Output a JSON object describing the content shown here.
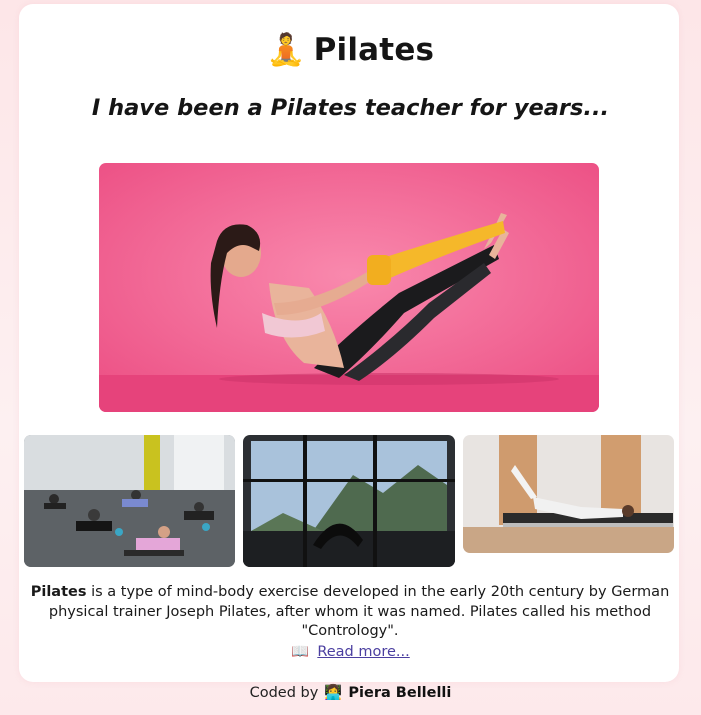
{
  "header": {
    "title_emoji": "🧘",
    "title": "Pilates",
    "subtitle": "I have been a Pilates teacher for years..."
  },
  "description": {
    "keyword": "Pilates",
    "text": " is a type of mind-body exercise developed in the early 20th century by German physical trainer Joseph Pilates, after whom it was named. Pilates called his method \"Contrology\".",
    "link_icon": "📖",
    "link_label": "Read more..."
  },
  "footer": {
    "prefix": "Coded by",
    "author_emoji": "👩‍💻",
    "author": "Piera Bellelli"
  },
  "colors": {
    "hero_pink": "#f0608e",
    "band_yellow": "#f5b82a",
    "link": "#4b3fa0"
  }
}
